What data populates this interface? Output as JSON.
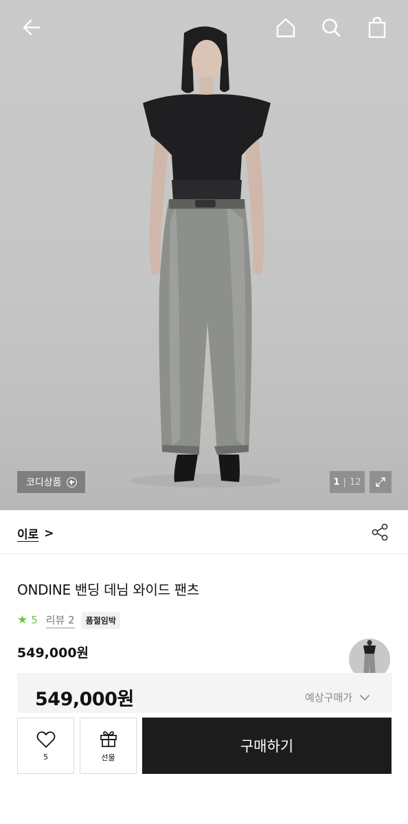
{
  "hero": {
    "codi_label": "코디상품",
    "image_index": "1",
    "image_separator": "|",
    "image_total": "12"
  },
  "brand": {
    "name": "이로",
    "chevron": ">"
  },
  "product": {
    "title": "ONDINE 밴딩 데님 와이드 팬츠",
    "rating_star": "★",
    "rating": "5",
    "review_label": "리뷰 2",
    "badge": "품절임박",
    "price": "549,000원"
  },
  "price_box": {
    "price": "549,000원",
    "estimate_label": "예상구매가"
  },
  "actions": {
    "like_count": "5",
    "gift_label": "선물",
    "buy_label": "구매하기"
  },
  "icons": {
    "back": "arrow-left-icon",
    "home": "home-icon",
    "search": "search-icon",
    "bag": "shopping-bag-icon",
    "share": "share-icon",
    "expand": "expand-icon",
    "heart": "heart-icon",
    "gift": "gift-icon"
  },
  "colors": {
    "accent_green": "#6cc24a",
    "buy_button": "#1c1c1c"
  }
}
